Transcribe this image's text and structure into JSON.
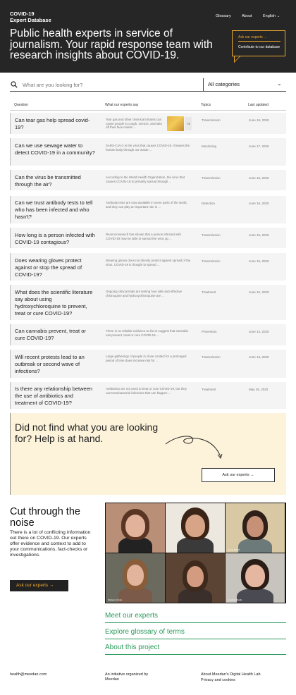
{
  "header": {
    "logo_line1": "COVID-19",
    "logo_line2": "Expert Database",
    "nav": [
      "Glossary",
      "About",
      "English"
    ],
    "headline": "Public health experts in service of journalism. Your rapid response team with research insights about COVID-19.",
    "ask_link": "Ask our experts",
    "ask_arrow": "→",
    "contribute_link": "Contribute to our database"
  },
  "search": {
    "placeholder": "What are you looking for?",
    "category": "All categories"
  },
  "table": {
    "headers": [
      "Question",
      "What our experts say",
      "Topics",
      "Last updated"
    ],
    "rows": [
      {
        "question": "Can tear gas help spread covid-19?",
        "answer": "Tear gas and other chemical irritants can cause people to cough, sneeze, and take off their face masks ...",
        "thumb_count": "+3",
        "topic": "Transmission",
        "date": "June 19, 2020"
      },
      {
        "question": "Can we use sewage water to detect COVID-19 in a community?",
        "answer": "SARS-CoV-2 is the virus that causes COVID-19. It leaves the human body through our waste ...",
        "topic": "Monitoring",
        "date": "June 17, 2020"
      },
      {
        "question": "Can the virus be transmitted through the air?",
        "answer": "According to the World Health Organization, the virus that causes COVID-19 is primarily spread through ...",
        "topic": "Transmission",
        "date": "June 16, 2020"
      },
      {
        "question": "Can we trust antibody tests to tell who has been infected and who hasn't?",
        "answer": "Antibody tests are now available in some parts of the world, and they can play an important role in ...",
        "topic": "Detection",
        "date": "June 16, 2020"
      },
      {
        "question": "How long is a person infected with COVID-19 contagious?",
        "answer": "Recent research has shown that a person infected with COVID-19 may be able to spread the virus up ...",
        "topic": "Transmission",
        "date": "June 15, 2020"
      },
      {
        "question": "Does wearing gloves protect against or stop the spread of COVID-19?",
        "answer": "Wearing gloves does not directly protect against spread of the virus. COVID-19 is thought to spread ...",
        "topic": "Transmission",
        "date": "June 15, 2020"
      },
      {
        "question": "What does the scientific literature say about using hydroxychloroquine to prevent, treat or cure COVID-19?",
        "answer": "Ongoing clinical trials are testing how safe and effective chloroquine and hydroxychloroquine are ...",
        "topic": "Treatment",
        "date": "June 15, 2020"
      },
      {
        "question": "Can cannabis prevent, treat or cure COVID-19?",
        "answer": "There is no reliable evidence so far to suggest that cannabis can prevent, treat or cure COVID-19 ...",
        "topic": "Prevention",
        "date": "June 13, 2020"
      },
      {
        "question": "Will recent protests lead to an outbreak or second wave of infections?",
        "answer": "Large gatherings of people in close contact for a prolonged period of time does increase risk for ...",
        "topic": "Transmission",
        "date": "June 13, 2020"
      },
      {
        "question": "Is there any relationship between the use of antibiotics and treatment of COVID-19?",
        "answer": "Antibiotics are not used to treat or cure COVID-19, but they can treat bacterial infections that can happen ...",
        "topic": "Treatment",
        "date": "May 26, 2020"
      }
    ]
  },
  "help": {
    "title": "Did not find what you are looking for? Help is at hand.",
    "button": "Ask our experts →"
  },
  "cut": {
    "title": "Cut through the noise",
    "body": "There is a lot of conflicting information out there on COVID-19. Our experts offer evidence and context to add to your communications, fact-checks or investigations.",
    "button": "Ask our experts →",
    "captions": [
      "Jenna Shroff",
      "Madelyn Hirota",
      "Carolina Basilio"
    ]
  },
  "links": [
    "Meet our experts",
    "Explore glossary of terms",
    "About this project"
  ],
  "footer": {
    "email": "health@meedan.com",
    "initiative": "An initiative organized by Meedan",
    "about_lab": "About Meedan's Digital Health Lab",
    "privacy": "Privacy and cookies"
  },
  "colors": {
    "accent": "#f0a92e",
    "dark": "#262626",
    "link_green": "#2a9a5b",
    "help_bg": "#fdf3da"
  }
}
